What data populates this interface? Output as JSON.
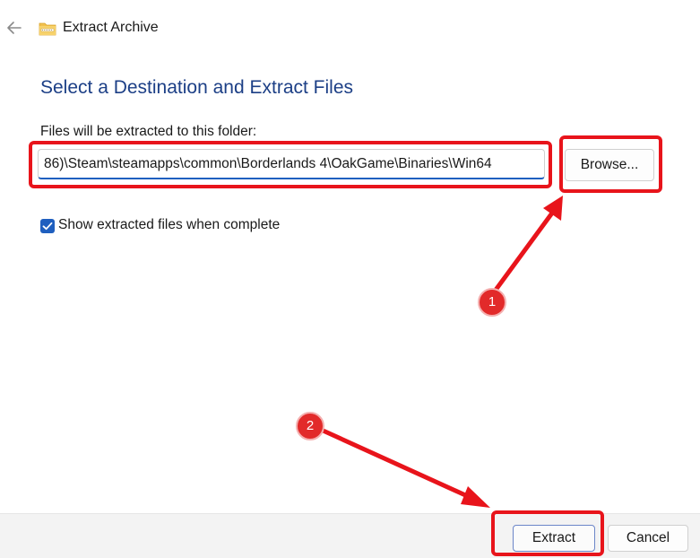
{
  "window": {
    "title": "Extract Archive"
  },
  "dialog": {
    "heading": "Select a Destination and Extract Files",
    "folder_label": "Files will be extracted to this folder:",
    "path_value": "86)\\Steam\\steamapps\\common\\Borderlands 4\\OakGame\\Binaries\\Win64",
    "browse_label": "Browse...",
    "show_files_label": "Show extracted files when complete",
    "show_files_checked": true
  },
  "footer": {
    "extract_label": "Extract",
    "cancel_label": "Cancel"
  },
  "annotations": {
    "step_1": "1",
    "step_2": "2",
    "highlight_color": "#e8141b"
  },
  "colors": {
    "heading": "#1c3f86",
    "accent": "#1f5fbf"
  }
}
